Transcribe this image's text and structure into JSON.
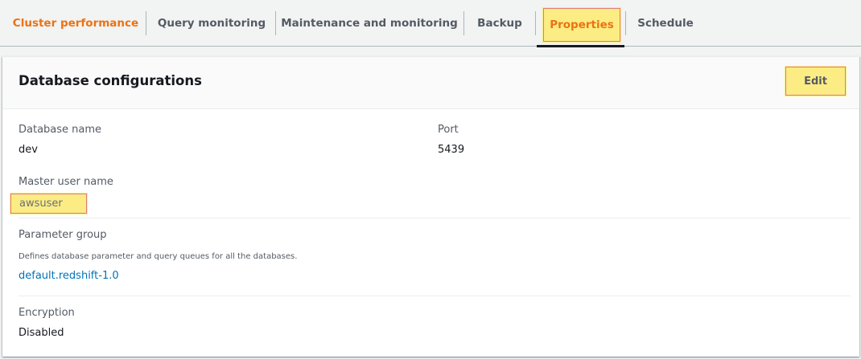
{
  "tabs": [
    {
      "label": "Cluster performance"
    },
    {
      "label": "Query monitoring"
    },
    {
      "label": "Maintenance and monitoring"
    },
    {
      "label": "Backup"
    },
    {
      "label": "Properties"
    },
    {
      "label": "Schedule"
    }
  ],
  "panel": {
    "title": "Database configurations",
    "edit_label": "Edit",
    "fields": {
      "database_name": {
        "label": "Database name",
        "value": "dev"
      },
      "port": {
        "label": "Port",
        "value": "5439"
      },
      "master_user": {
        "label": "Master user name",
        "value": "awsuser"
      },
      "parameter_group": {
        "label": "Parameter group",
        "description": "Defines database parameter and query queues for all the databases.",
        "value": "default.redshift-1.0"
      },
      "encryption": {
        "label": "Encryption",
        "value": "Disabled"
      }
    }
  },
  "colors": {
    "accent_orange": "#ec7211",
    "highlight_yellow": "#fcec84",
    "highlight_border": "#e07b7b",
    "link_blue": "#0073bb"
  }
}
